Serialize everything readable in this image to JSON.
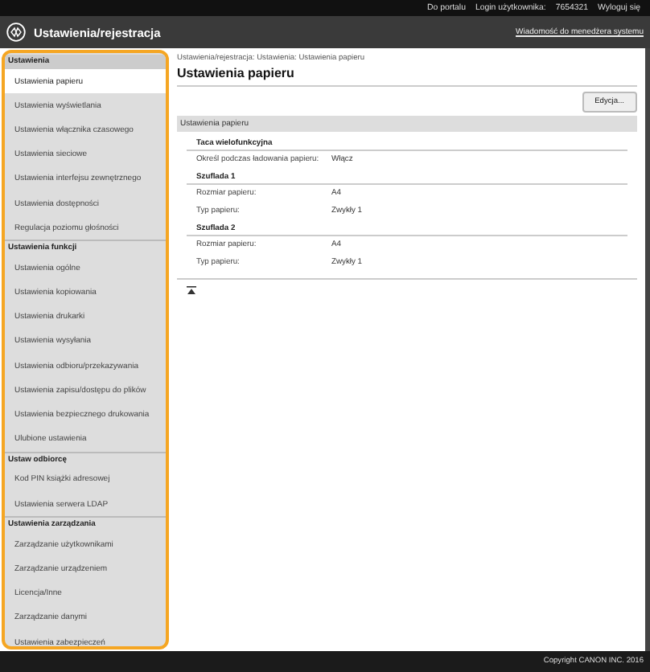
{
  "top_bar": {
    "portal_link": "Do portalu",
    "user_label": "Login użytkownika:",
    "user_id": "7654321",
    "logout_link": "Wyloguj się"
  },
  "header": {
    "title": "Ustawienia/rejestracja",
    "message_link": "Wiadomość do menedżera systemu"
  },
  "sidebar": {
    "sections": [
      {
        "title": "Ustawienia",
        "items": [
          {
            "label": "Ustawienia papieru",
            "selected": true
          },
          {
            "label": "Ustawienia wyświetlania",
            "selected": false
          },
          {
            "label": "Ustawienia włącznika czasowego",
            "selected": false
          },
          {
            "label": "Ustawienia sieciowe",
            "selected": false
          },
          {
            "label": "Ustawienia interfejsu zewnętrznego",
            "selected": false
          },
          {
            "label": "Ustawienia dostępności",
            "selected": false
          },
          {
            "label": "Regulacja poziomu głośności",
            "selected": false
          }
        ]
      },
      {
        "title": "Ustawienia funkcji",
        "items": [
          {
            "label": "Ustawienia ogólne",
            "selected": false
          },
          {
            "label": "Ustawienia kopiowania",
            "selected": false
          },
          {
            "label": "Ustawienia drukarki",
            "selected": false
          },
          {
            "label": "Ustawienia wysyłania",
            "selected": false
          },
          {
            "label": "Ustawienia odbioru/przekazywania",
            "selected": false
          },
          {
            "label": "Ustawienia zapisu/dostępu do plików",
            "selected": false
          },
          {
            "label": "Ustawienia bezpiecznego drukowania",
            "selected": false
          },
          {
            "label": "Ulubione ustawienia",
            "selected": false
          }
        ]
      },
      {
        "title": "Ustaw odbiorcę",
        "items": [
          {
            "label": "Kod PIN książki adresowej",
            "selected": false
          },
          {
            "label": "Ustawienia serwera LDAP",
            "selected": false
          }
        ]
      },
      {
        "title": "Ustawienia zarządzania",
        "items": [
          {
            "label": "Zarządzanie użytkownikami",
            "selected": false
          },
          {
            "label": "Zarządzanie urządzeniem",
            "selected": false
          },
          {
            "label": "Licencja/Inne",
            "selected": false
          },
          {
            "label": "Zarządzanie danymi",
            "selected": false
          },
          {
            "label": "Ustawienia zabezpieczeń",
            "selected": false
          }
        ]
      }
    ]
  },
  "main": {
    "breadcrumb": "Ustawienia/rejestracja: Ustawienia: Ustawienia papieru",
    "title": "Ustawienia papieru",
    "edit_button": "Edycja...",
    "panel": {
      "title": "Ustawienia papieru",
      "groups": [
        {
          "title": "Taca wielofunkcyjna",
          "rows": [
            {
              "label": "Określ podczas ładowania papieru:",
              "value": "Włącz"
            }
          ]
        },
        {
          "title": "Szuflada 1",
          "rows": [
            {
              "label": "Rozmiar papieru:",
              "value": "A4"
            },
            {
              "label": "Typ papieru:",
              "value": "Zwykły 1"
            }
          ]
        },
        {
          "title": "Szuflada 2",
          "rows": [
            {
              "label": "Rozmiar papieru:",
              "value": "A4"
            },
            {
              "label": "Typ papieru:",
              "value": "Zwykły 1"
            }
          ]
        }
      ]
    }
  },
  "footer": {
    "copyright": "Copyright CANON INC. 2016"
  }
}
